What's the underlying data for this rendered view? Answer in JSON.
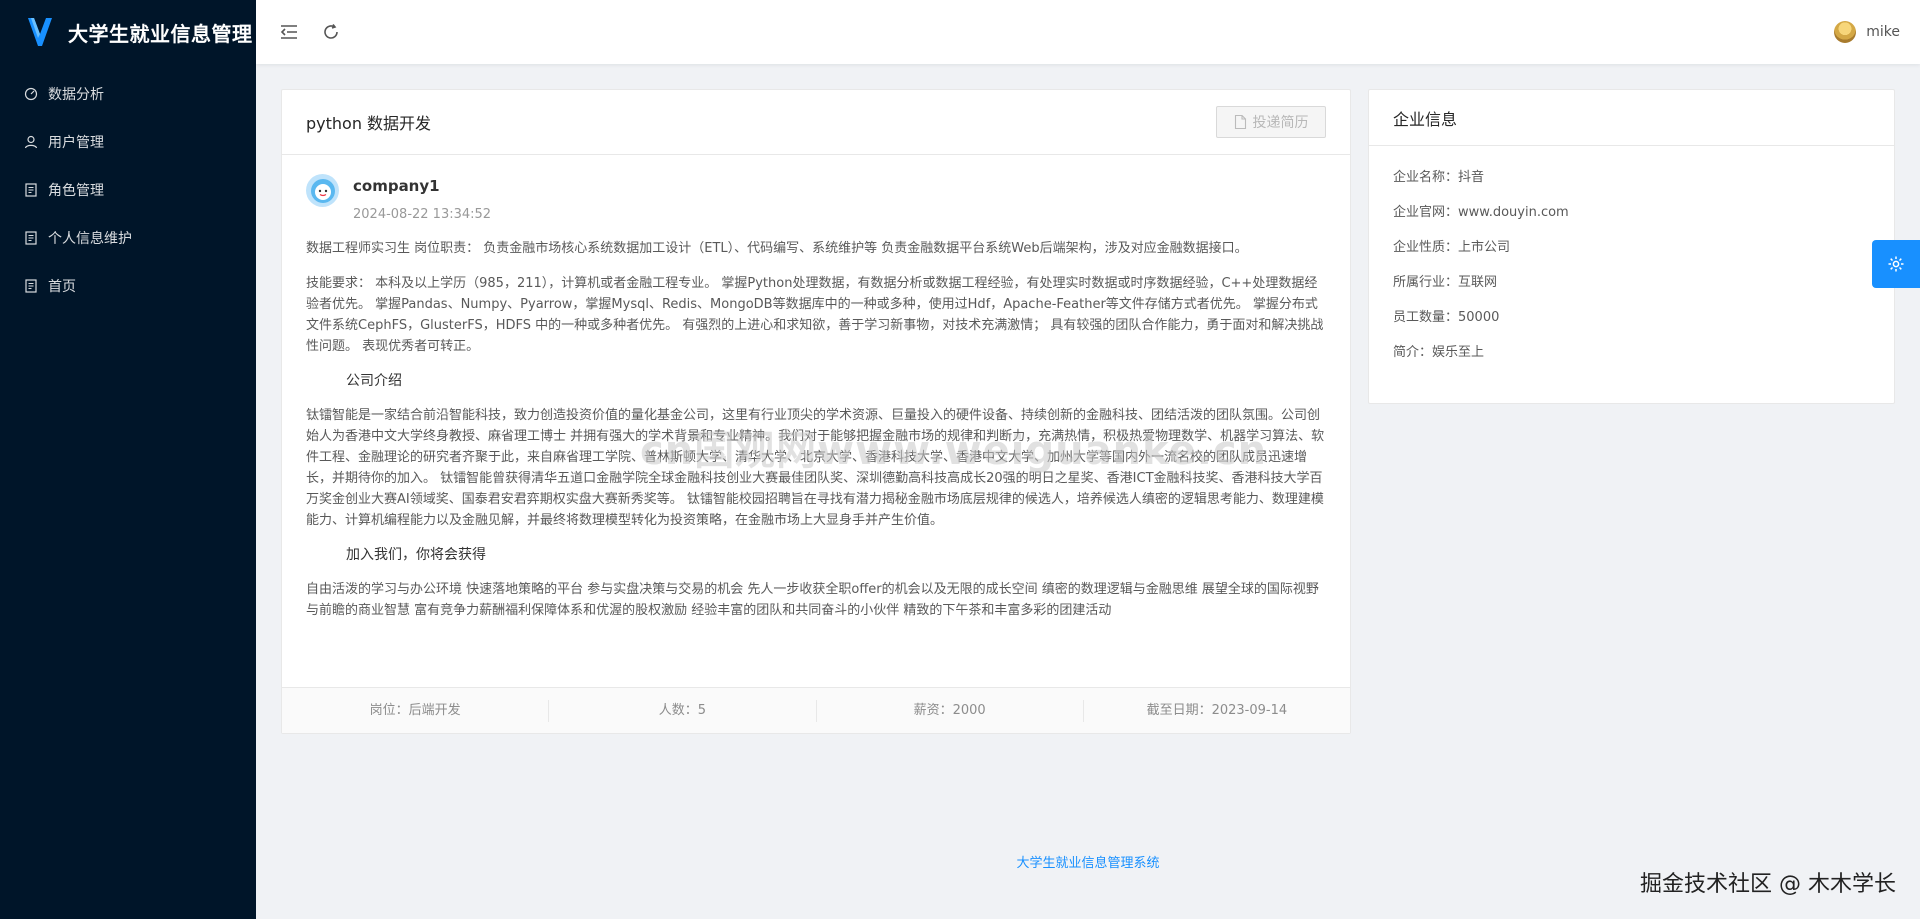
{
  "app": {
    "title": "大学生就业信息管理",
    "footer_link": "大学生就业信息管理系统"
  },
  "sidebar": {
    "items": [
      {
        "label": "数据分析",
        "icon": "dashboard-icon"
      },
      {
        "label": "用户管理",
        "icon": "user-icon"
      },
      {
        "label": "角色管理",
        "icon": "document-icon"
      },
      {
        "label": "个人信息维护",
        "icon": "document-icon"
      },
      {
        "label": "首页",
        "icon": "document-icon"
      }
    ]
  },
  "header": {
    "username": "mike"
  },
  "job": {
    "title": "python 数据开发",
    "apply_label": "投递简历",
    "company_name": "company1",
    "posted_time": "2024-08-22 13:34:52",
    "paragraphs": {
      "duty": "数据工程师实习生 岗位职责： 负责金融市场核心系统数据加工设计（ETL）、代码编写、系统维护等 负责金融数据平台系统Web后端架构，涉及对应金融数据接口。",
      "skills": "技能要求： 本科及以上学历（985，211），计算机或者金融工程专业。 掌握Python处理数据，有数据分析或数据工程经验，有处理实时数据或时序数据经验，C++处理数据经验者优先。 掌握Pandas、Numpy、Pyarrow，掌握Mysql、Redis、MongoDB等数据库中的一种或多种，使用过Hdf，Apache-Feather等文件存储方式者优先。 掌握分布式文件系统CephFS，GlusterFS，HDFS 中的一种或多种者优先。 有强烈的上进心和求知欲，善于学习新事物，对技术充满激情； 具有较强的团队合作能力，勇于面对和解决挑战性问题。 表现优秀者可转正。",
      "intro_heading": "公司介绍",
      "intro": "钛镭智能是一家结合前沿智能科技，致力创造投资价值的量化基金公司，这里有行业顶尖的学术资源、巨量投入的硬件设备、持续创新的金融科技、团结活泼的团队氛围。公司创始人为香港中文大学终身教授、麻省理工博士 并拥有强大的学术背景和专业精神。我们对于能够把握金融市场的规律和判断力，充满热情，积极热爱物理数学、机器学习算法、软件工程、金融理论的研究者齐聚于此，来自麻省理工学院、普林斯顿大学、清华大学、北京大学、香港科技大学、香港中文大学、加州大学等国内外一流名校的团队成员迅速增长，并期待你的加入。 钛镭智能曾获得清华五道口金融学院全球金融科技创业大赛最佳团队奖、深圳德勤高科技高成长20强的明日之星奖、香港ICT金融科技奖、香港科技大学百万奖金创业大赛AI领域奖、国泰君安君弈期权实盘大赛新秀奖等。 钛镭智能校园招聘旨在寻找有潜力揭秘金融市场底层规律的候选人，培养候选人缜密的逻辑思考能力、数理建模能力、计算机编程能力以及金融见解，并最终将数理模型转化为投资策略，在金融市场上大显身手并产生价值。",
      "join_heading": "加入我们，你将会获得",
      "join": "自由活泼的学习与办公环境 快速落地策略的平台 参与实盘决策与交易的机会 先人一步收获全职offer的机会以及无限的成长空间 缜密的数理逻辑与金融思维 展望全球的国际视野与前瞻的商业智慧 富有竞争力薪酬福利保障体系和优渥的股权激励 经验丰富的团队和共同奋斗的小伙伴 精致的下午茶和丰富多彩的团建活动"
    },
    "footer": {
      "position": "岗位：后端开发",
      "headcount": "人数：5",
      "salary": "薪资：2000",
      "deadline": "截至日期：2023-09-14"
    }
  },
  "company": {
    "heading": "企业信息",
    "fields": [
      "企业名称：抖音",
      "企业官网：www.douyin.com",
      "企业性质：上市公司",
      "所属行业：互联网",
      "员工数量：50000",
      "简介：娱乐至上"
    ]
  },
  "watermarks": {
    "center": "cn国观网www.weiguanke.cn",
    "bottom_right": "掘金技术社区 @ 木木学长"
  },
  "colors": {
    "sidebar_bg": "#001529",
    "accent": "#1890ff"
  }
}
